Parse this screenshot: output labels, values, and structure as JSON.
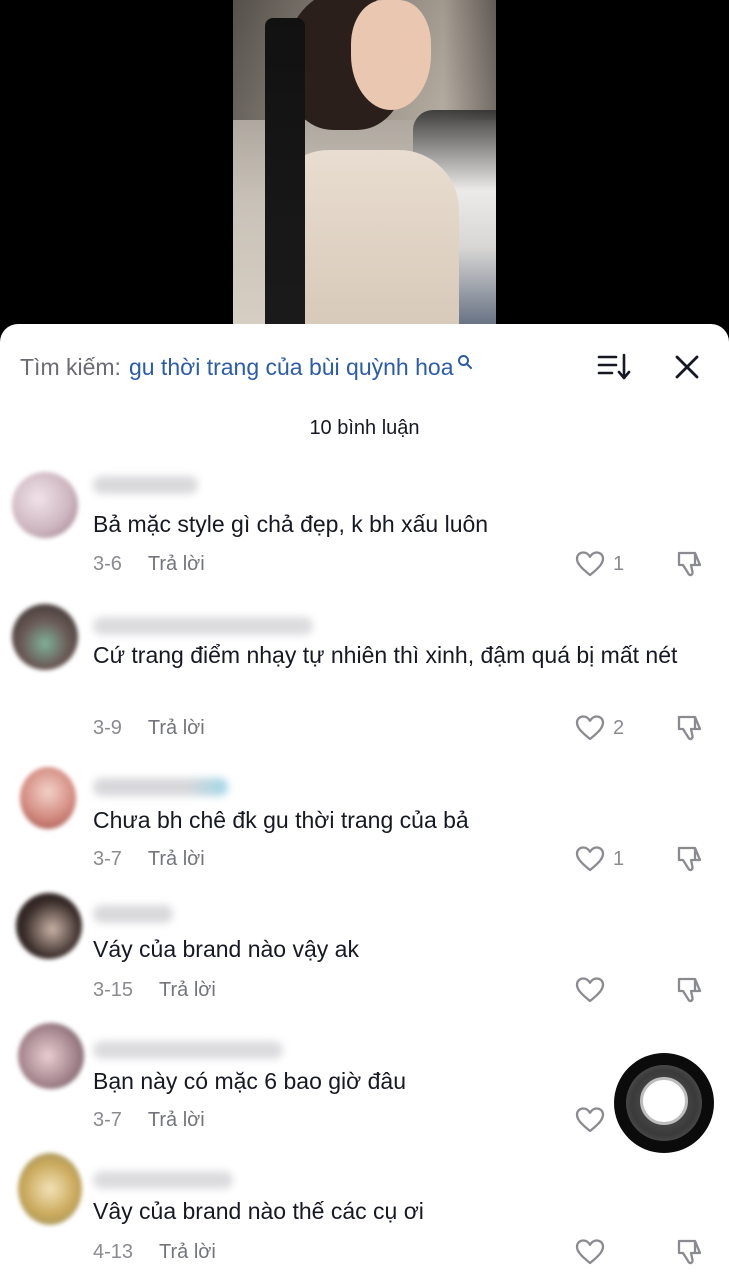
{
  "search": {
    "prefix": "Tìm kiếm:",
    "query": "gu thời trang của bùi quỳnh hoa"
  },
  "comment_count_label": "10 bình luận",
  "video": {
    "watermark": ""
  },
  "comments": [
    {
      "text": "Bả mặc style gì chả đẹp, k bh xấu luôn",
      "date": "3-6",
      "reply_label": "Trả lời",
      "likes": "1"
    },
    {
      "text": "Cứ trang điểm nhạy tự nhiên thì xinh, đậm quá bị mất nét",
      "date": "3-9",
      "reply_label": "Trả lời",
      "likes": "2"
    },
    {
      "text": "Chưa bh chê đk gu thời trang của bả",
      "date": "3-7",
      "reply_label": "Trả lời",
      "likes": "1"
    },
    {
      "text": "Váy của brand nào vậy ak",
      "date": "3-15",
      "reply_label": "Trả lời",
      "likes": ""
    },
    {
      "text": "Bạn này có mặc 6 bao giờ đâu",
      "date": "3-7",
      "reply_label": "Trả lời",
      "likes": ""
    },
    {
      "text": "Vây của brand nào thế các cụ ơi",
      "date": "4-13",
      "reply_label": "Trả lời",
      "likes": ""
    }
  ],
  "colors": {
    "accent": "#2b5cab",
    "text": "#161823",
    "muted": "#8a8b91"
  }
}
